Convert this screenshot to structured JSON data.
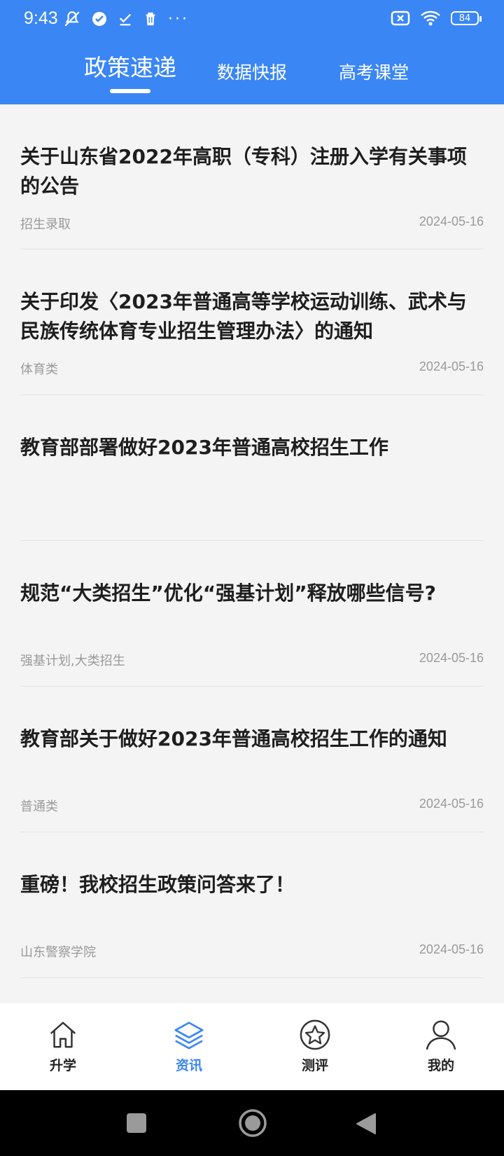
{
  "status": {
    "time": "9:43",
    "left_icons": [
      "mute-icon",
      "check-circle-icon",
      "download-done-icon",
      "trash-icon"
    ],
    "dots": "···",
    "right_icons": [
      "no-sim-icon",
      "wifi-icon"
    ],
    "battery": "84"
  },
  "tabs": [
    {
      "label": "政策速递",
      "active": true
    },
    {
      "label": "数据快报",
      "active": false
    },
    {
      "label": "高考课堂",
      "active": false
    }
  ],
  "articles": [
    {
      "title": "关于山东省2022年高职（专科）注册入学有关事项的公告",
      "tag": "招生录取",
      "date": "2024-05-16"
    },
    {
      "title": "关于印发〈2023年普通高等学校运动训练、武术与民族传统体育专业招生管理办法〉的通知",
      "tag": "体育类",
      "date": "2024-05-16"
    },
    {
      "title": "教育部部署做好2023年普通高校招生工作",
      "tag": "",
      "date": ""
    },
    {
      "title": "规范“大类招生”优化“强基计划”释放哪些信号?",
      "tag": "强基计划,大类招生",
      "date": "2024-05-16"
    },
    {
      "title": "教育部关于做好2023年普通高校招生工作的通知",
      "tag": "普通类",
      "date": "2024-05-16"
    },
    {
      "title": "重磅！我校招生政策问答来了！",
      "tag": "山东警察学院",
      "date": "2024-05-16"
    }
  ],
  "bottom_nav": [
    {
      "label": "升学",
      "icon": "home-icon",
      "active": false
    },
    {
      "label": "资讯",
      "icon": "layers-icon",
      "active": true
    },
    {
      "label": "测评",
      "icon": "star-circle-icon",
      "active": false
    },
    {
      "label": "我的",
      "icon": "user-icon",
      "active": false
    }
  ],
  "colors": {
    "accent": "#3a86f5",
    "background": "#f4f4f4"
  }
}
